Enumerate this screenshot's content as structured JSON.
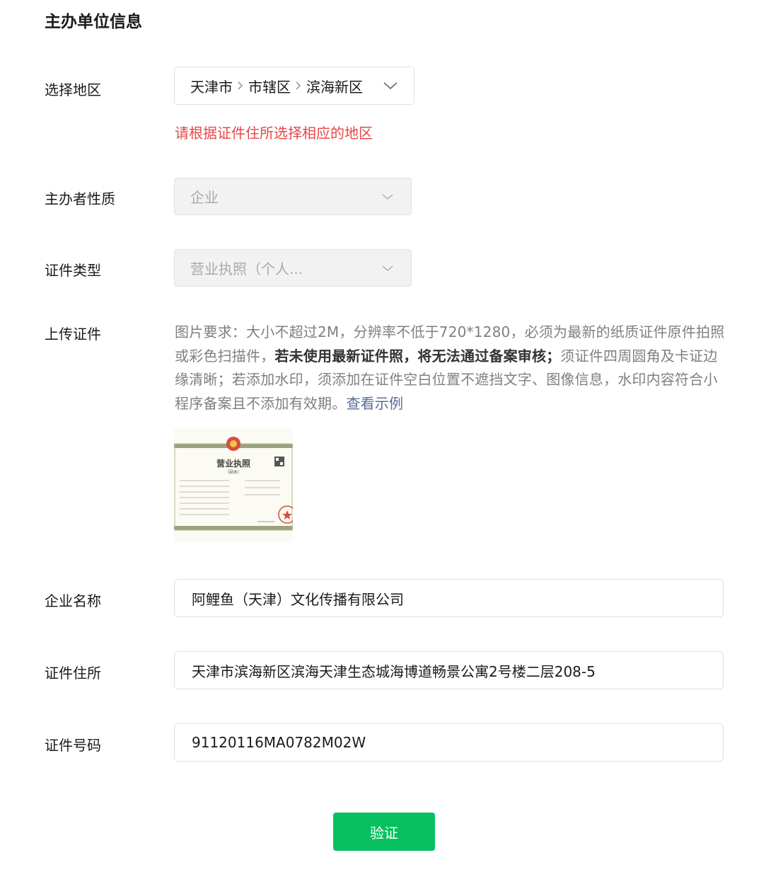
{
  "section_title": "主办单位信息",
  "region": {
    "label": "选择地区",
    "parts": [
      "天津市",
      "市辖区",
      "滨海新区"
    ],
    "hint": "请根据证件住所选择相应的地区"
  },
  "sponsor_type": {
    "label": "主办者性质",
    "value": "企业"
  },
  "cert_type": {
    "label": "证件类型",
    "value": "营业执照（个人..."
  },
  "upload": {
    "label": "上传证件",
    "desc_part1": "图片要求：大小不超过2M，分辨率不低于720*1280，必须为最新的纸质证件原件拍照或彩色扫描件，",
    "desc_bold": "若未使用最新证件照，将无法通过备案审核；",
    "desc_part2": "须证件四周圆角及卡证边缘清晰；若添加水印，须添加在证件空白位置不遮挡文字、图像信息，水印内容符合小程序备案且不添加有效期。",
    "example_link": "查看示例",
    "license_title": "营业执照",
    "license_sub": "（副本）"
  },
  "company_name": {
    "label": "企业名称",
    "value": "阿鲤鱼（天津）文化传播有限公司"
  },
  "cert_address": {
    "label": "证件住所",
    "value": "天津市滨海新区滨海天津生态城海博道畅景公寓2号楼二层208-5"
  },
  "cert_number": {
    "label": "证件号码",
    "value": "91120116MA0782M02W"
  },
  "verify_button": "验证",
  "colors": {
    "accent": "#07c160",
    "error": "#e84747",
    "link": "#576b95"
  }
}
